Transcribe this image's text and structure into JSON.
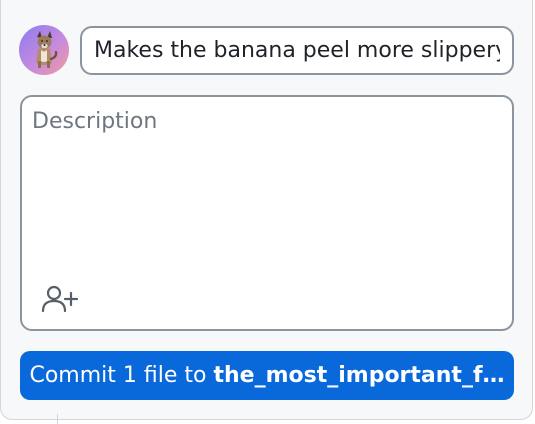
{
  "commit_form": {
    "avatar_icon": "dog-avatar",
    "summary": {
      "value": "Makes the banana peel more slippery"
    },
    "description": {
      "value": "",
      "placeholder": "Description"
    },
    "coauthor_icon": "person-add-icon",
    "commit_button": {
      "prefix": "Commit 1 file to ",
      "branch": "the_most_important_f…"
    }
  },
  "colors": {
    "primary": "#0969da",
    "panel_bg": "#f6f8fa",
    "border": "#8c959f"
  }
}
